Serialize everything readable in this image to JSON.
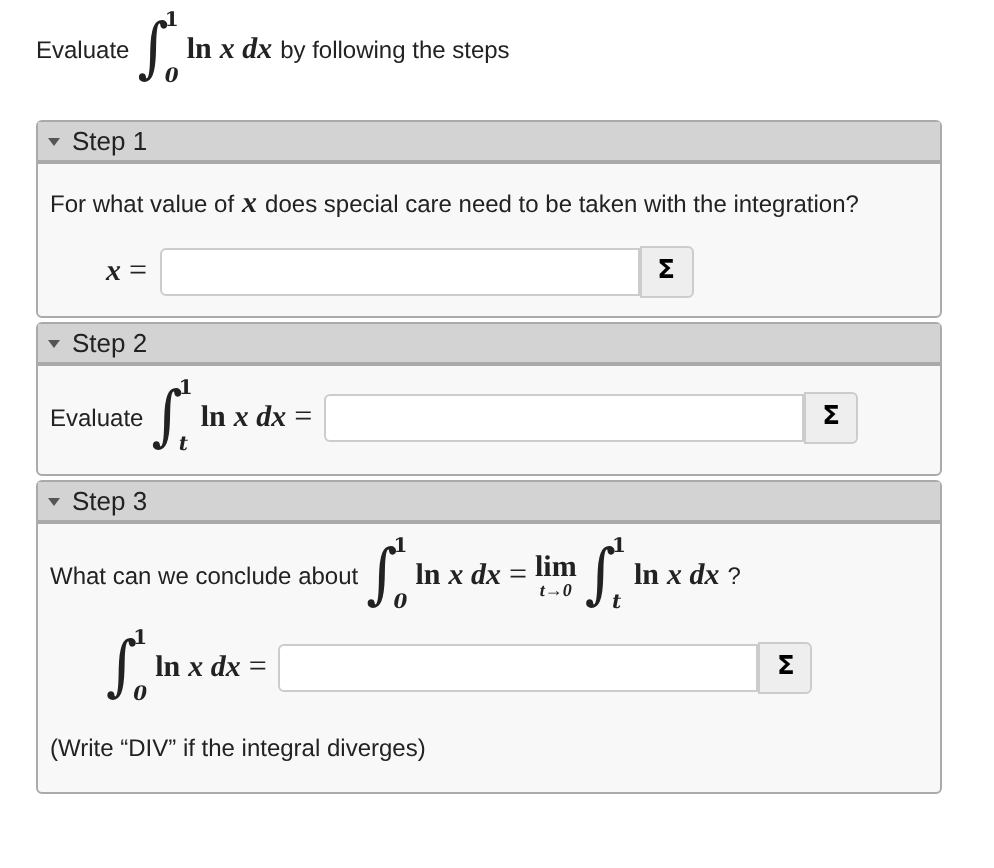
{
  "title": [
    {
      "kind": "text",
      "text": "Evaluate"
    },
    {
      "kind": "int",
      "symbol": "∫",
      "lower": "0",
      "upper": "1"
    },
    {
      "kind": "op",
      "text": "ln"
    },
    {
      "kind": "var",
      "text": "x dx"
    },
    {
      "kind": "text",
      "text": "by following the steps"
    }
  ],
  "steps": [
    {
      "title": "Step 1",
      "expanded": true,
      "rows": [
        {
          "kind": "sentence",
          "parts": [
            {
              "kind": "text",
              "text": "For what value of"
            },
            {
              "kind": "var",
              "text": "x"
            },
            {
              "kind": "text",
              "text": "does special care need to be taken with the integration?"
            }
          ]
        },
        {
          "kind": "answer",
          "button": "Σ",
          "parts": [
            {
              "kind": "var",
              "text": "x"
            },
            {
              "kind": "rel",
              "text": "="
            }
          ]
        }
      ]
    },
    {
      "title": "Step 2",
      "expanded": true,
      "rows": [
        {
          "kind": "answer",
          "button": "Σ",
          "parts": [
            {
              "kind": "text",
              "text": "Evaluate"
            },
            {
              "kind": "int",
              "symbol": "∫",
              "lower": "t",
              "upper": "1"
            },
            {
              "kind": "op",
              "text": "ln"
            },
            {
              "kind": "var",
              "text": "x dx"
            },
            {
              "kind": "rel",
              "text": "="
            }
          ]
        }
      ]
    },
    {
      "title": "Step 3",
      "expanded": true,
      "rows": [
        {
          "kind": "sentence",
          "parts": [
            {
              "kind": "text",
              "text": "What can we conclude about"
            },
            {
              "kind": "int",
              "symbol": "∫",
              "lower": "0",
              "upper": "1"
            },
            {
              "kind": "op",
              "text": "ln"
            },
            {
              "kind": "var",
              "text": "x dx"
            },
            {
              "kind": "rel",
              "text": "="
            },
            {
              "kind": "lim",
              "text": "lim",
              "sub": "t→0"
            },
            {
              "kind": "int",
              "symbol": "∫",
              "lower": "t",
              "upper": "1"
            },
            {
              "kind": "op",
              "text": "ln"
            },
            {
              "kind": "var",
              "text": "x dx"
            },
            {
              "kind": "text",
              "text": "?"
            }
          ]
        },
        {
          "kind": "answer",
          "button": "Σ",
          "parts": [
            {
              "kind": "int",
              "symbol": "∫",
              "lower": "0",
              "upper": "1"
            },
            {
              "kind": "op",
              "text": "ln"
            },
            {
              "kind": "var",
              "text": "x dx"
            },
            {
              "kind": "rel",
              "text": "="
            }
          ]
        },
        {
          "kind": "sentence",
          "parts": [
            {
              "kind": "text",
              "text": "(Write “DIV” if the integral diverges)"
            }
          ]
        }
      ]
    }
  ]
}
